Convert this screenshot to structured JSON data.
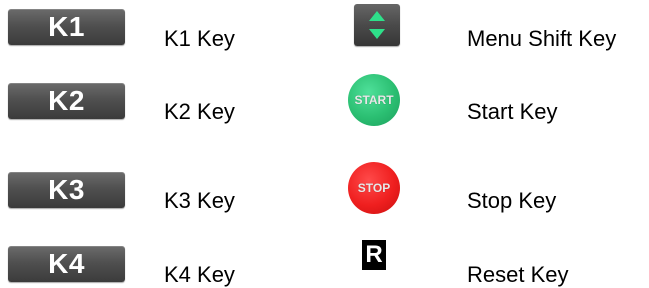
{
  "keys_left": [
    {
      "key": "K1",
      "label": "K1 Key"
    },
    {
      "key": "K2",
      "label": "K2 Key"
    },
    {
      "key": "K3",
      "label": "K3 Key"
    },
    {
      "key": "K4",
      "label": "K4 Key"
    }
  ],
  "keys_right": [
    {
      "icon": "menu-shift-icon",
      "label": "Menu Shift Key"
    },
    {
      "icon": "start-key-icon",
      "key": "START",
      "label": "Start Key"
    },
    {
      "icon": "stop-key-icon",
      "key": "STOP",
      "label": "Stop Key"
    },
    {
      "icon": "reset-key-icon",
      "key": "R",
      "label": "Reset Key"
    }
  ],
  "colors": {
    "key_gray": "#505050",
    "arrow_green": "#2ee08a",
    "start_green": "#2bbf72",
    "stop_red": "#ef1f1f",
    "reset_black": "#000000"
  }
}
